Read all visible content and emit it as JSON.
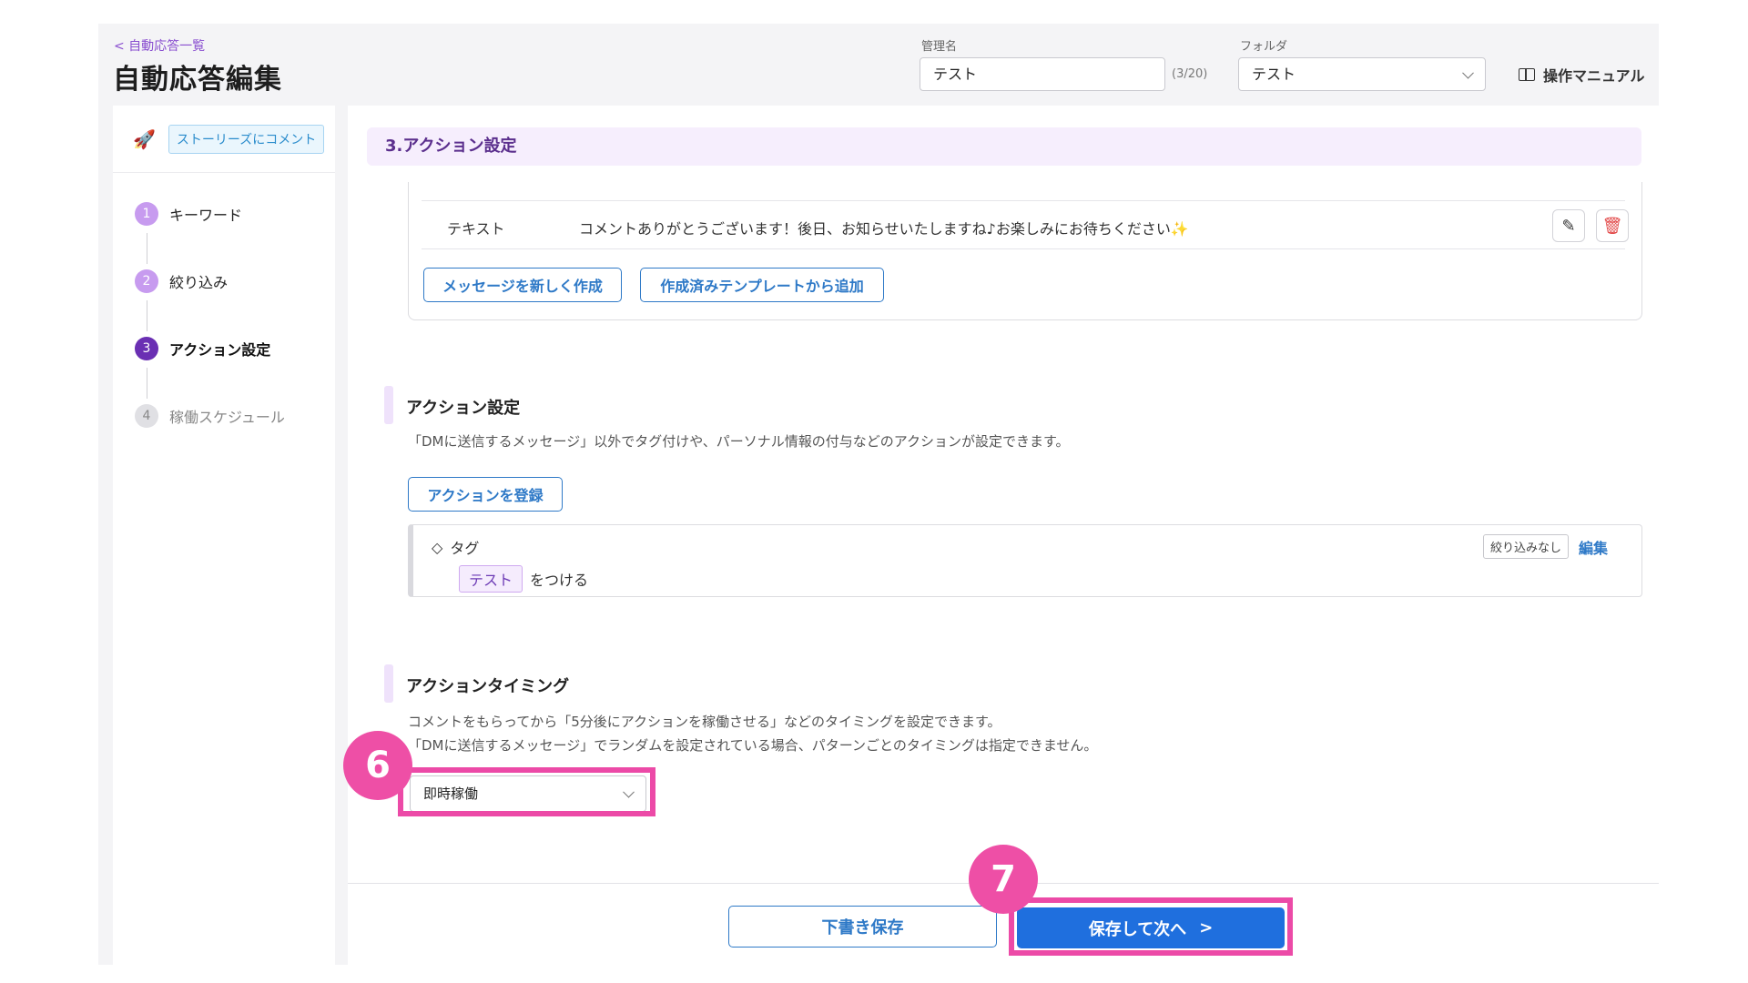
{
  "header": {
    "back_link": "< 自動応答一覧",
    "title": "自動応答編集",
    "name_label": "管理名",
    "name_value": "テスト",
    "name_counter": "(3/20)",
    "folder_label": "フォルダ",
    "folder_value": "テスト",
    "manual_label": "操作マニュアル"
  },
  "sidebar": {
    "trigger_badge": "ストーリーズにコメント",
    "steps": [
      {
        "num": "1",
        "label": "キーワード"
      },
      {
        "num": "2",
        "label": "絞り込み"
      },
      {
        "num": "3",
        "label": "アクション設定"
      },
      {
        "num": "4",
        "label": "稼働スケジュール"
      }
    ]
  },
  "main": {
    "section_title": "3.アクション設定",
    "message_row": {
      "type": "テキスト",
      "text": "コメントありがとうございます！後日、お知らせいたしますね♪お楽しみにお待ちください✨"
    },
    "new_message_button": "メッセージを新しく作成",
    "add_template_button": "作成済みテンプレートから追加",
    "action_title": "アクション設定",
    "action_desc": "「DMに送信するメッセージ」以外でタグ付けや、パーソナル情報の付与などのアクションが設定できます。",
    "register_action_button": "アクションを登録",
    "tag_card": {
      "head": "タグ",
      "chip": "テスト",
      "suffix": "をつける",
      "filter_badge": "絞り込みなし",
      "edit_link": "編集"
    },
    "timing_title": "アクションタイミング",
    "timing_desc_1": "コメントをもらってから「5分後にアクションを稼働させる」などのタイミングを設定できます。",
    "timing_desc_2": "「DMに送信するメッセージ」でランダムを設定されている場合、パターンごとのタイミングは指定できません。",
    "timing_select": "即時稼働"
  },
  "footer": {
    "draft_button": "下書き保存",
    "save_next_button": "保存して次へ",
    "save_next_arrow": ">"
  },
  "markers": {
    "m6": "6",
    "m7": "7"
  },
  "colors": {
    "accent_blue": "#1f6fde",
    "accent_purple": "#5b2f8d",
    "highlight_pink": "#ec4aa7",
    "step_active": "#6a2fb3",
    "step_done": "#c79bef",
    "step_pending": "#e0e0e4"
  }
}
